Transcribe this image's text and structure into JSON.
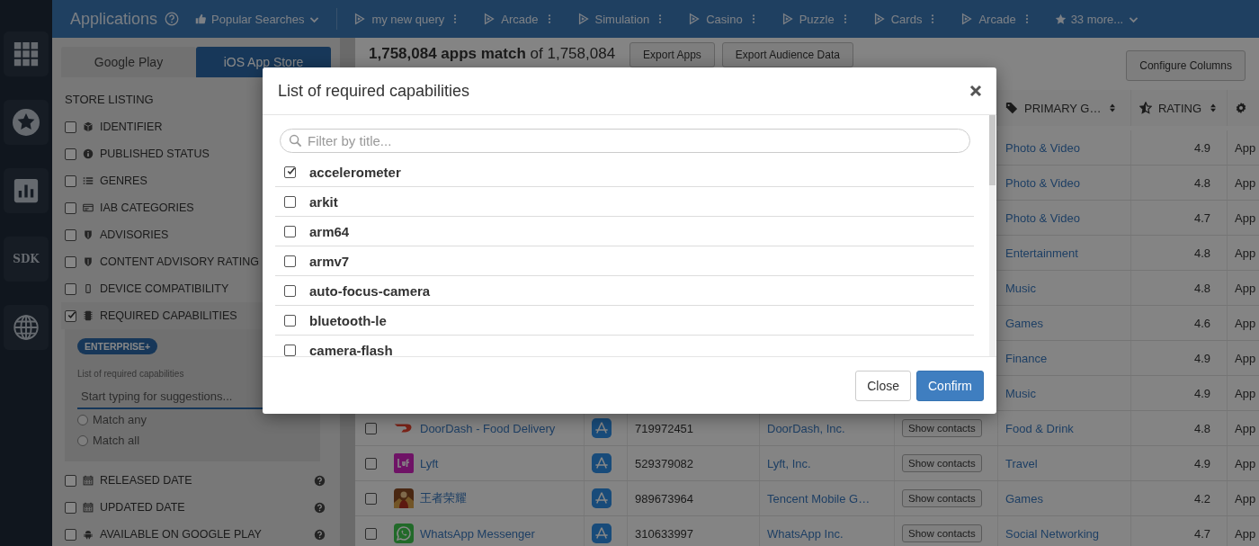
{
  "topbar": {
    "title": "Applications",
    "popular": "Popular Searches",
    "queries": [
      {
        "label": "my new query"
      },
      {
        "label": "Arcade"
      },
      {
        "label": "Simulation"
      },
      {
        "label": "Casino"
      },
      {
        "label": "Puzzle"
      },
      {
        "label": "Cards"
      },
      {
        "label": "Arcade"
      }
    ],
    "more": "33 more..."
  },
  "rail": [
    {
      "kind": "apps"
    },
    {
      "kind": "favorites"
    },
    {
      "kind": "analytics"
    },
    {
      "kind": "sdk",
      "label": "SDK"
    },
    {
      "kind": "globe"
    }
  ],
  "store_tabs": [
    {
      "label": "Google Play",
      "selected": false
    },
    {
      "label": "iOS App Store",
      "selected": true
    }
  ],
  "filters": {
    "heading": "STORE LISTING",
    "items": [
      {
        "label": "IDENTIFIER",
        "kind": "cube",
        "checked": false,
        "expanded": false,
        "help": false
      },
      {
        "label": "PUBLISHED STATUS",
        "kind": "info",
        "checked": false,
        "expanded": false,
        "help": false
      },
      {
        "label": "GENRES",
        "kind": "list",
        "checked": false,
        "expanded": false,
        "help": false
      },
      {
        "label": "IAB CATEGORIES",
        "kind": "card",
        "checked": false,
        "expanded": false,
        "help": false
      },
      {
        "label": "ADVISORIES",
        "kind": "shield",
        "checked": false,
        "expanded": false,
        "help": false
      },
      {
        "label": "CONTENT ADVISORY RATING",
        "kind": "shield",
        "checked": false,
        "expanded": false,
        "help": false
      },
      {
        "label": "DEVICE COMPATIBILITY",
        "kind": "phone",
        "checked": false,
        "expanded": false,
        "help": false
      },
      {
        "label": "REQUIRED CAPABILITIES",
        "kind": "chip",
        "checked": true,
        "expanded": true,
        "help": false,
        "panel": {
          "badge": "ENTERPRISE+",
          "field_label": "List of required capabilities",
          "placeholder": "Start typing for suggestions...",
          "options": [
            {
              "label": "Match any",
              "selected": false
            },
            {
              "label": "Match all",
              "selected": false
            }
          ]
        }
      },
      {
        "label": "RELEASED DATE",
        "kind": "calendar",
        "checked": false,
        "expanded": false,
        "help": true
      },
      {
        "label": "UPDATED DATE",
        "kind": "calendar",
        "checked": false,
        "expanded": false,
        "help": true
      },
      {
        "label": "AVAILABLE ON GOOGLE PLAY",
        "kind": "android",
        "checked": false,
        "expanded": false,
        "help": true
      }
    ]
  },
  "results": {
    "summary": "**1,758,084 apps match** of 1,758,084",
    "buttons": [
      "Export Apps",
      "Export Audience Data"
    ],
    "configure": "Configure Columns"
  },
  "table": {
    "columns": [
      {
        "kind": "genre",
        "label": "PRIMARY G…"
      },
      {
        "kind": "rating",
        "label": "RATING"
      },
      {
        "kind": "settings"
      }
    ],
    "rows": [
      {
        "genre": "Photo & Video",
        "rating": "4.9",
        "column_9": "App"
      },
      {
        "genre": "Photo & Video",
        "rating": "4.8",
        "column_9": "App"
      },
      {
        "genre": "Photo & Video",
        "rating": "4.7",
        "column_9": "App"
      },
      {
        "genre": "Entertainment",
        "rating": "4.8",
        "column_9": "App"
      },
      {
        "genre": "Music",
        "rating": "4.8",
        "column_9": "App"
      },
      {
        "genre": "Games",
        "rating": "4.6",
        "column_9": "App"
      },
      {
        "genre": "Finance",
        "rating": "4.9",
        "column_9": "App"
      },
      {
        "genre": "Music",
        "rating": "4.9",
        "column_9": "App"
      },
      {
        "checked": false,
        "kind": "swoosh",
        "name": "DoorDash - Food Delivery",
        "app_id": "719972451",
        "publisher": "DoorDash, Inc.",
        "contacts": "Show contacts",
        "genre": "Food & Drink",
        "rating": "4.8",
        "column_9": "App"
      },
      {
        "checked": false,
        "kind": "square",
        "name": "Lyft",
        "app_id": "529379082",
        "publisher": "Lyft, Inc.",
        "contacts": "Show contacts",
        "genre": "Travel",
        "rating": "4.9",
        "column_9": "App"
      },
      {
        "checked": false,
        "kind": "figure",
        "name": "王者荣耀",
        "app_id": "989673964",
        "publisher": "Tencent Mobile G…",
        "contacts": "Show contacts",
        "genre": "Games",
        "rating": "4.2",
        "column_9": "App"
      },
      {
        "checked": false,
        "kind": "chat",
        "name": "WhatsApp Messenger",
        "app_id": "310633997",
        "publisher": "WhatsApp Inc.",
        "contacts": "Show contacts",
        "genre": "Social Networking",
        "rating": "4.7",
        "column_9": "App"
      }
    ]
  },
  "modal": {
    "title": "List of required capabilities",
    "search_placeholder": "Filter by title...",
    "items": [
      {
        "label": "accelerometer",
        "checked": true
      },
      {
        "label": "arkit",
        "checked": false
      },
      {
        "label": "arm64",
        "checked": false
      },
      {
        "label": "armv7",
        "checked": false
      },
      {
        "label": "auto-focus-camera",
        "checked": false
      },
      {
        "label": "bluetooth-le",
        "checked": false
      },
      {
        "label": "camera-flash",
        "checked": false
      }
    ],
    "buttons": [
      {
        "label": "Close",
        "kind": "default"
      },
      {
        "label": "Confirm",
        "kind": "primary"
      }
    ]
  }
}
